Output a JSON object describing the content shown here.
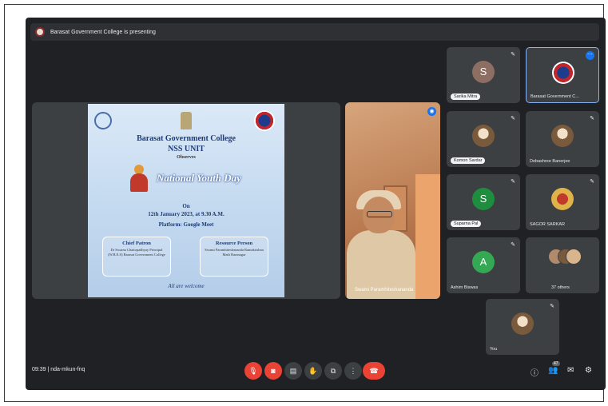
{
  "presenting_bar": {
    "text": "Barasat Government College is presenting"
  },
  "poster": {
    "college": "Barasat Government College",
    "unit": "NSS UNIT",
    "observes": "Observes",
    "event": "National Youth Day",
    "on": "On",
    "date": "12th January 2023, at 9.30 A.M.",
    "platform": "Platform: Google Meet",
    "chief_title": "Chief Patron",
    "chief_text": "Dr Swarna Chattopadhyay Principal (W.B.E.S) Barasat Government College",
    "resource_title": "Resource Person",
    "resource_text": "Swami Paramhiteshananda Ramakrishna Math Baranagar",
    "welcome": "All are welcome"
  },
  "speaker": {
    "name": "Swami Paramhiteshananda"
  },
  "participants": [
    {
      "name": "Sarika Mitra",
      "initial": "S",
      "color": "#8d6e63"
    },
    {
      "name": "Barasat Government C...",
      "initial": "",
      "color": "#ffffff"
    },
    {
      "name": "Komon Sardar",
      "initial": "",
      "color": "#9e9e9e"
    },
    {
      "name": "Debashree Banerjee",
      "initial": "",
      "color": "#9e9e9e"
    },
    {
      "name": "Suparna Pal",
      "initial": "S",
      "color": "#1e8e3e"
    },
    {
      "name": "SAGOR SARKAR",
      "initial": "",
      "color": "#e0b34a"
    },
    {
      "name": "Ashim Biswas",
      "initial": "A",
      "color": "#34a853"
    },
    {
      "name": "37 others",
      "initial": "",
      "color": "#9e9e9e"
    },
    {
      "name": "You",
      "initial": "",
      "color": "#9e9e9e"
    }
  ],
  "bottom_bar": {
    "meeting_info": "09:39 | nda-mkun-fnq",
    "people_badge": "47"
  }
}
